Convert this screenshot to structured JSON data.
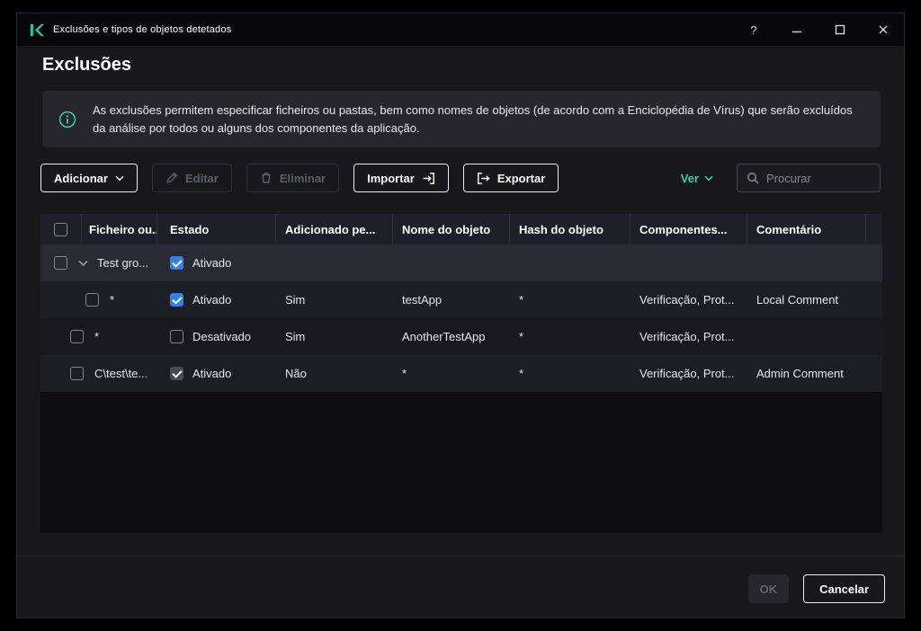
{
  "window": {
    "title": "Exclusões e tipos de objetos detetados",
    "help_glyph": "?"
  },
  "page": {
    "title": "Exclusões"
  },
  "banner": {
    "text": "As exclusões permitem especificar ficheiros ou pastas, bem como nomes de objetos (de acordo com a Enciclopédia de Vírus) que serão excluídos da análise por todos ou alguns dos componentes da aplicação."
  },
  "toolbar": {
    "add_label": "Adicionar",
    "edit_label": "Editar",
    "delete_label": "Eliminar",
    "import_label": "Importar",
    "export_label": "Exportar",
    "view_label": "Ver",
    "search_placeholder": "Procurar"
  },
  "table": {
    "columns": [
      "Ficheiro ou...",
      "Estado",
      "Adicionado pe...",
      "Nome do objeto",
      "Hash do objeto",
      "Componentes...",
      "Comentário"
    ],
    "group_row": {
      "name": "Test gro...",
      "status_label": "Ativado",
      "status_cb": {
        "checked": true,
        "disabled": false
      }
    },
    "rows": [
      {
        "file": "*",
        "status_label": "Ativado",
        "status_cb": {
          "checked": true,
          "disabled": false
        },
        "added": "Sim",
        "name": "testApp",
        "hash": "*",
        "components": "Verificação, Prot...",
        "comment": "Local Comment"
      },
      {
        "file": "*",
        "status_label": "Desativado",
        "status_cb": {
          "checked": false,
          "disabled": false
        },
        "added": "Sim",
        "name": "AnotherTestApp",
        "hash": "*",
        "components": "Verificação, Prot...",
        "comment": ""
      },
      {
        "file": "C\\test\\te...",
        "status_label": "Ativado",
        "status_cb": {
          "checked": true,
          "disabled": true
        },
        "added": "Não",
        "name": "*",
        "hash": "*",
        "components": "Verificação, Prot...",
        "comment": "Admin Comment"
      }
    ]
  },
  "footer": {
    "ok_label": "OK",
    "cancel_label": "Cancelar"
  },
  "colors": {
    "accent_green": "#36d0a2",
    "checkbox_blue": "#2f81ed"
  }
}
